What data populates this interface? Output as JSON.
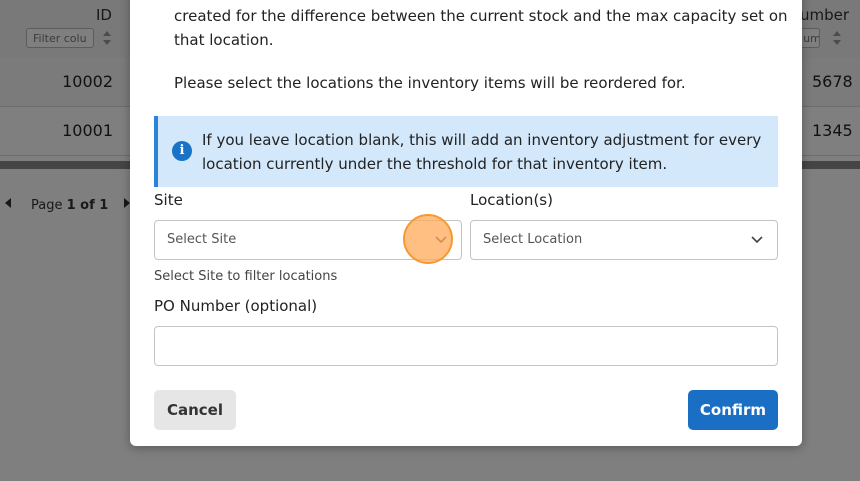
{
  "table": {
    "col_id": "ID",
    "col_right": "umber",
    "filter_placeholder": "Filter colu",
    "filter_right_placeholder": "ilum",
    "rows": [
      {
        "id": "10002",
        "right": "5678"
      },
      {
        "id": "10001",
        "right": "1345"
      }
    ]
  },
  "pager": {
    "prefix": "Page ",
    "current": "1 of 1"
  },
  "modal": {
    "intro_line1": "created for the difference between the current stock and the max capacity set on",
    "intro_line2": "that location.",
    "instruction": "Please select the locations the inventory items will be reordered for.",
    "info_text": "If you leave location blank, this will add an inventory adjustment for every location currently under the threshold for that inventory item.",
    "info_icon": "i",
    "site_label": "Site",
    "site_placeholder": "Select Site",
    "site_hint": "Select Site to filter locations",
    "location_label": "Location(s)",
    "location_placeholder": "Select Location",
    "po_label": "PO Number (optional)",
    "po_value": "",
    "cancel_label": "Cancel",
    "confirm_label": "Confirm"
  },
  "colors": {
    "primary": "#1a6fc4",
    "info_bg": "#d3e8fb",
    "cursor": "#f59a32"
  }
}
